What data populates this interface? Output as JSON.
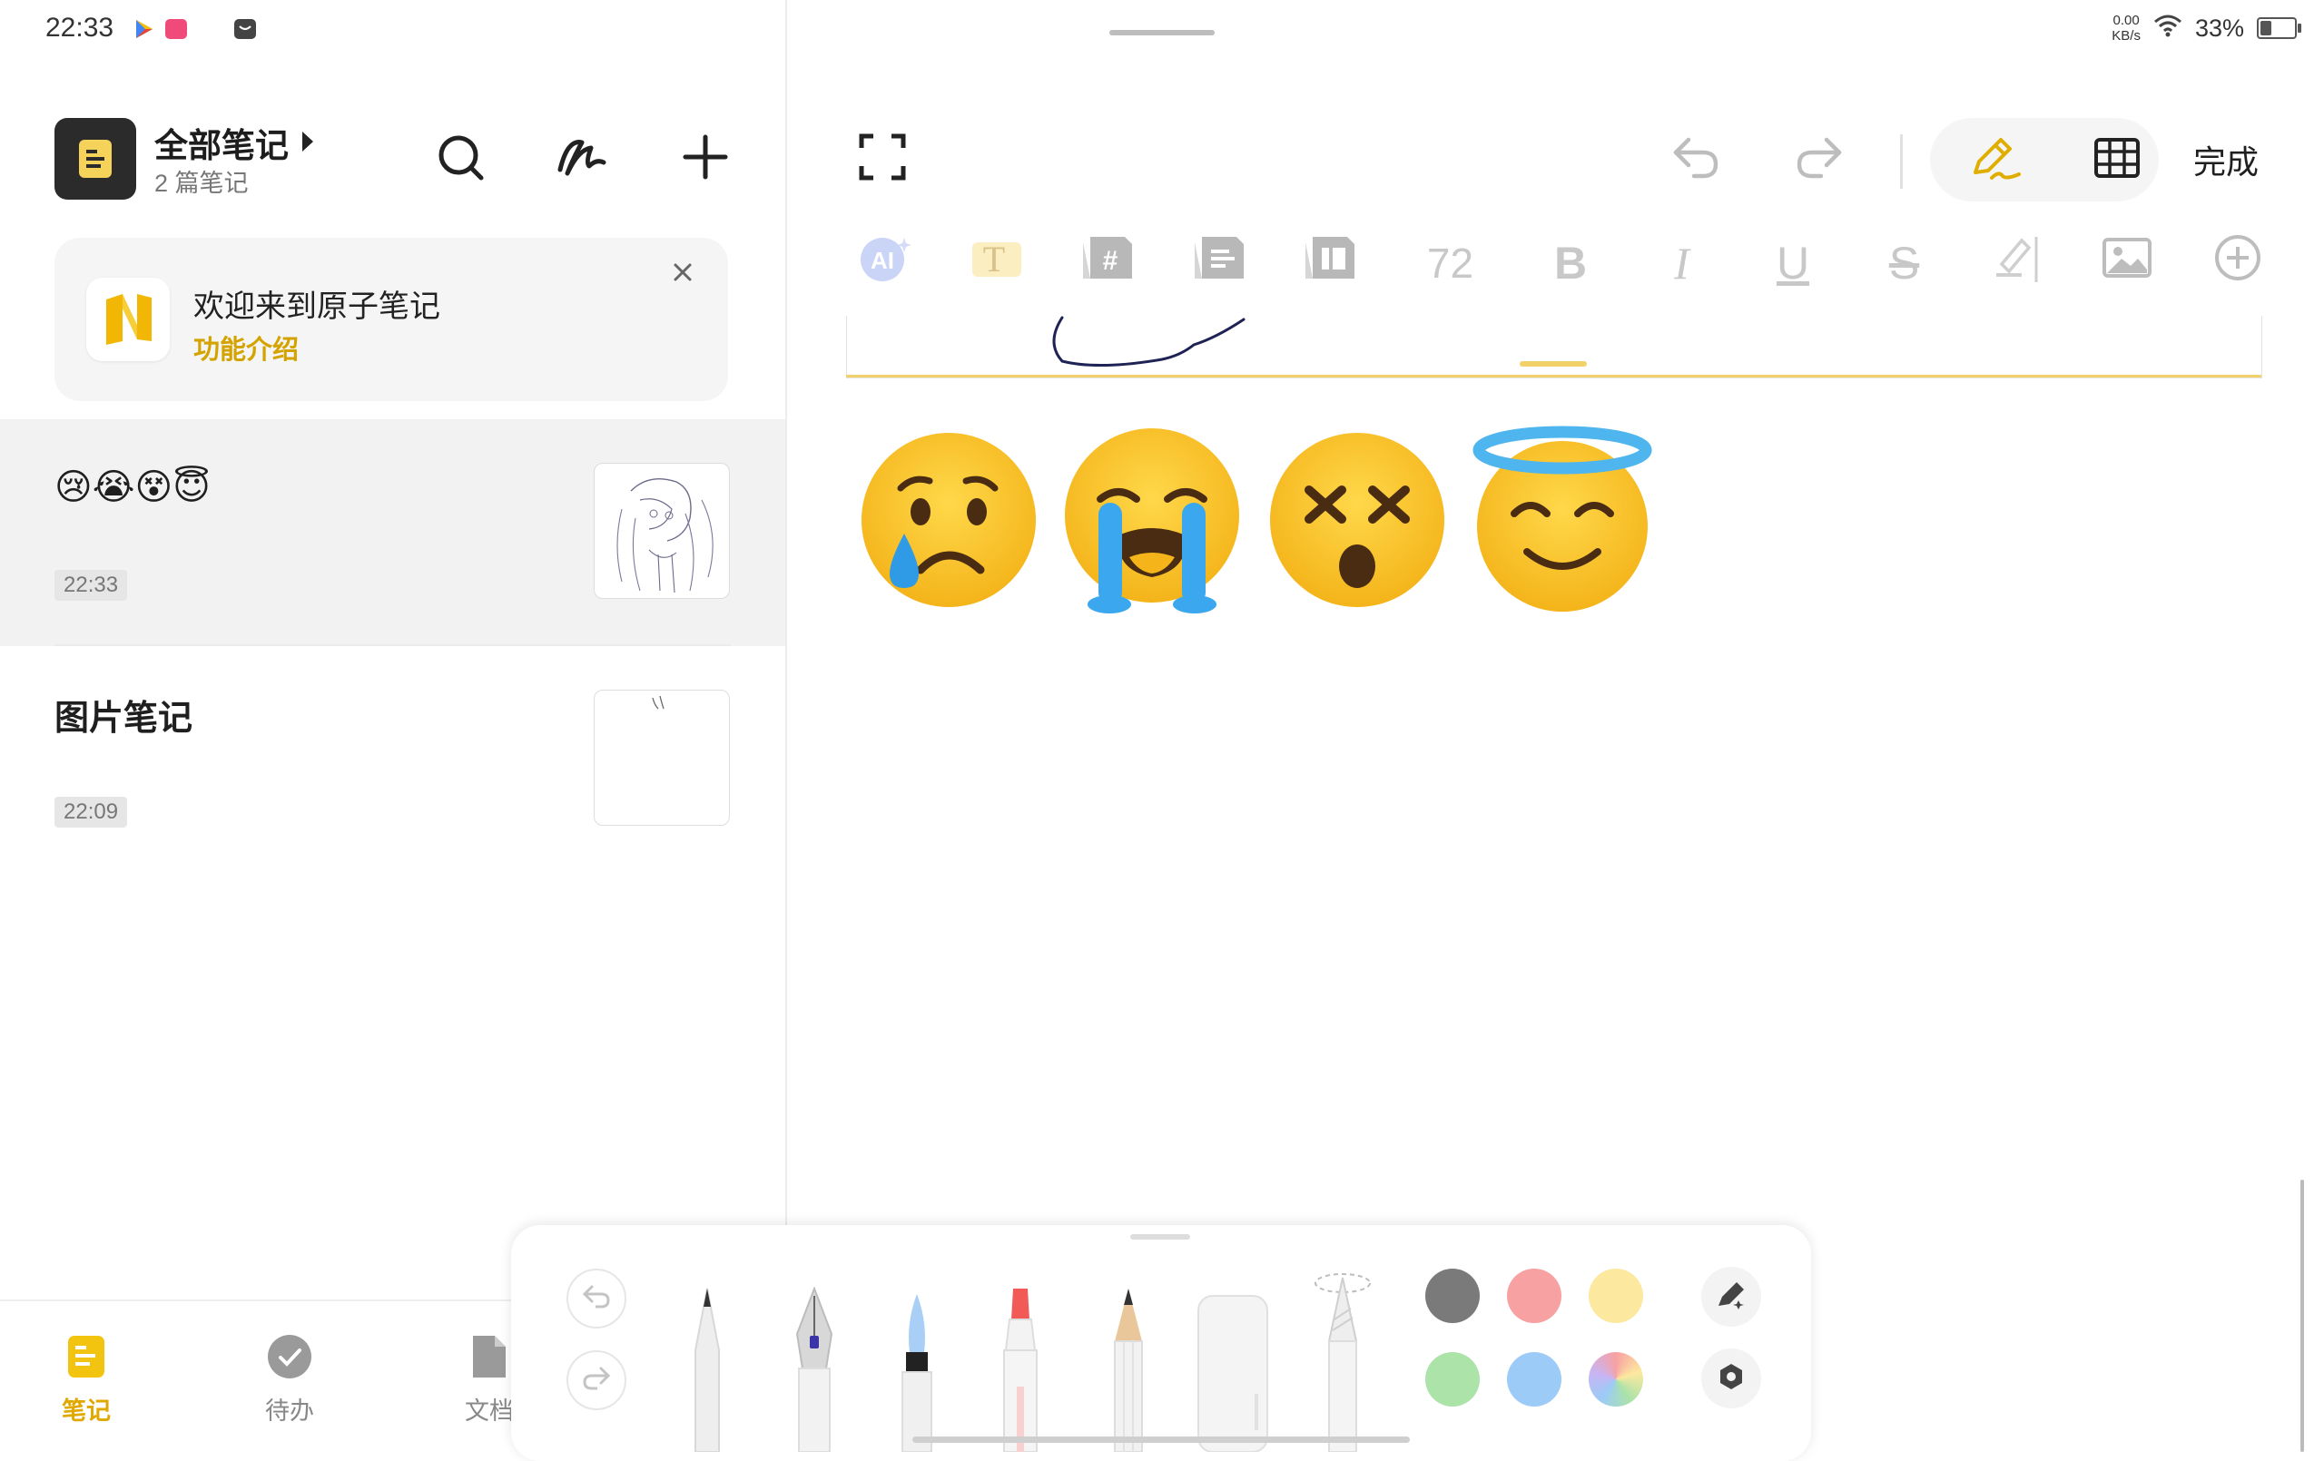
{
  "status_bar": {
    "time": "22:33",
    "net_speed_value": "0.00",
    "net_speed_unit": "KB/s",
    "battery_percent": "33%",
    "battery_level": 0.33,
    "icons": [
      "play-store-icon",
      "app-notification-icon",
      "message-icon",
      "wifi-icon",
      "battery-icon"
    ]
  },
  "sidebar": {
    "title": "全部笔记",
    "subtitle": "2 篇笔记",
    "actions": [
      "search-icon",
      "handwriting-icon",
      "plus-icon"
    ]
  },
  "welcome": {
    "title": "欢迎来到原子笔记",
    "link": "功能介绍",
    "logo_letter": "N"
  },
  "notes": [
    {
      "title": "😢😭😵😇",
      "time": "22:33",
      "selected": true
    },
    {
      "title": "图片笔记",
      "time": "22:09",
      "selected": false
    }
  ],
  "bottom_nav": [
    {
      "label": "笔记",
      "icon": "note-icon",
      "active": true
    },
    {
      "label": "待办",
      "icon": "todo-check-icon",
      "active": false
    },
    {
      "label": "文档",
      "icon": "document-icon",
      "active": false
    }
  ],
  "editor": {
    "done_label": "完成",
    "toolbar_icons": [
      "fullscreen-icon",
      "undo-icon",
      "redo-icon",
      "pen-mode-icon",
      "grid-icon"
    ],
    "format_bar": {
      "ai_label": "AI",
      "text_style_label": "T",
      "heading_label": "#",
      "font_size": "72",
      "bold_label": "B",
      "italic_label": "I",
      "underline_label": "U",
      "strike_label": "S",
      "icons": [
        "ai-icon",
        "text-style-icon",
        "heading-icon",
        "list-block-icon",
        "columns-icon",
        "font-size",
        "bold-icon",
        "italic-icon",
        "underline-icon",
        "strikethrough-icon",
        "highlighter-icon",
        "image-icon",
        "add-circle-icon"
      ]
    },
    "content_emoji": [
      "😢",
      "😭",
      "😵",
      "😇"
    ]
  },
  "pen_panel": {
    "tools": [
      "ballpoint-pen",
      "fountain-pen",
      "brush-pen",
      "marker-pen",
      "pencil",
      "eraser",
      "lasso-tool"
    ],
    "colors": [
      "#7a7a7a",
      "#f7a1a3",
      "#fde8a0",
      "#abe3a8",
      "#9ccbf7",
      "rainbow"
    ],
    "side_icons": [
      "pen-settings-icon",
      "hexagon-settings-icon"
    ]
  }
}
